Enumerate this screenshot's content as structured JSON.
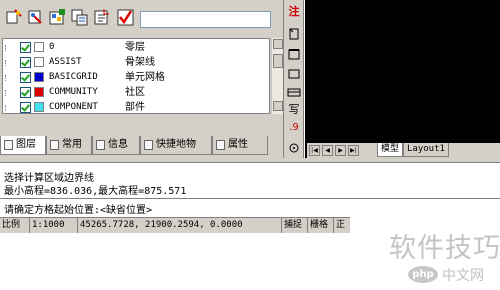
{
  "layers": [
    {
      "name": "0",
      "desc": "零层",
      "visible": true,
      "color": "#ffffff"
    },
    {
      "name": "ASSIST",
      "desc": "骨架线",
      "visible": true,
      "color": "#ffffff"
    },
    {
      "name": "BASICGRID",
      "desc": "单元网格",
      "visible": true,
      "color": "#0000cc"
    },
    {
      "name": "COMMUNITY",
      "desc": "社区",
      "visible": true,
      "color": "#dd0000"
    },
    {
      "name": "COMPONENT",
      "desc": "部件",
      "visible": true,
      "color": "#40e0f0"
    }
  ],
  "tabs": [
    "图层",
    "常用",
    "信息",
    "快捷地物",
    "属性"
  ],
  "palette": {
    "top_label": "注",
    "lower_glyph": "写",
    "value_label": ".9"
  },
  "layout_tabs": [
    "模型",
    "Layout1"
  ],
  "command": {
    "line1": "选择计算区域边界线",
    "line2": "最小高程=836.036,最大高程=875.571",
    "prompt": "请确定方格起始位置:<缺省位置>"
  },
  "status": {
    "scale_label": "比例",
    "scale_value": "1:1000",
    "coords": "45265.7728, 21900.2594, 0.0000",
    "snap": "捕捉",
    "grid": "栅格",
    "ortho": "正"
  },
  "watermark": {
    "text": "软件技巧",
    "site": "中文网",
    "logo": "php"
  },
  "colors": {
    "panel": "#d4d0c8",
    "drawing_bg": "#000000",
    "check": "#21a121",
    "accent_red": "#cc0000"
  }
}
